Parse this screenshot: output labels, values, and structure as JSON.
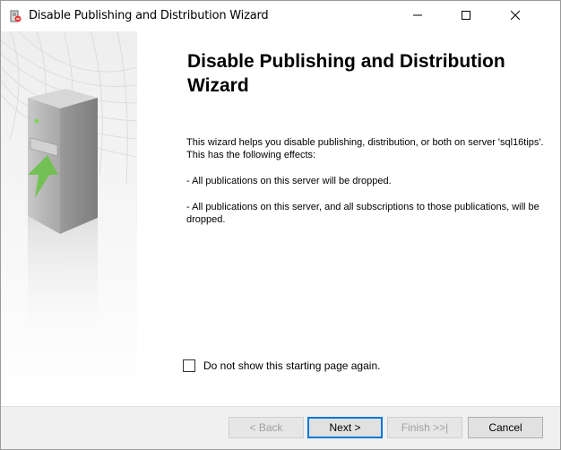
{
  "window": {
    "title": "Disable Publishing and Distribution Wizard",
    "icons": {
      "app": "replication-wizard-icon",
      "minimize": "minimize-icon",
      "maximize": "maximize-icon",
      "close": "close-icon"
    }
  },
  "page": {
    "heading": "Disable Publishing and Distribution Wizard",
    "intro": "This wizard helps you disable publishing, distribution, or both on server 'sql16tips'. This has the following effects:",
    "effects": [
      "- All publications on this server will be dropped.",
      "- All publications on this server, and all subscriptions to those publications, will be dropped."
    ],
    "checkbox": {
      "label": "Do not show this starting page again.",
      "checked": false
    }
  },
  "buttons": {
    "back": "< Back",
    "next": "Next >",
    "finish": "Finish >>|",
    "cancel": "Cancel"
  },
  "colors": {
    "accent": "#0078d7",
    "footer_bg": "#f0f0f0",
    "arrow_green": "#6cc24a"
  }
}
